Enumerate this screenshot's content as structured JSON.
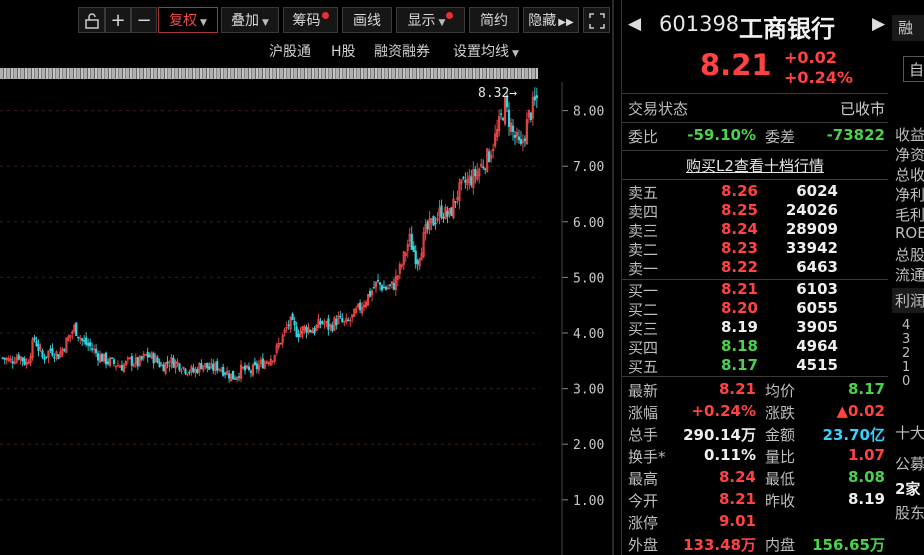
{
  "toolbar": {
    "plus": "+",
    "minus": "−",
    "fuquan": "复权",
    "diejia": "叠加",
    "chouma": "筹码",
    "huaxian": "画线",
    "xianshi": "显示",
    "jianyue": "简约",
    "yincang": "隐藏"
  },
  "subbar": {
    "hgt": "沪股通",
    "h_share": "H股",
    "margin": "融资融券",
    "set_ma": "设置均线"
  },
  "stock": {
    "code": "601398",
    "name": "工商银行",
    "price": "8.21",
    "change": "+0.02",
    "change_pct": "+0.24%"
  },
  "status": {
    "label": "交易状态",
    "value": "已收市"
  },
  "weibi": {
    "label1": "委比",
    "value1": "-59.10%",
    "label2": "委差",
    "value2": "-73822"
  },
  "l2_link": "购买L2查看十档行情",
  "asks": [
    {
      "label": "卖五",
      "price": "8.26",
      "vol": "6024"
    },
    {
      "label": "卖四",
      "price": "8.25",
      "vol": "24026"
    },
    {
      "label": "卖三",
      "price": "8.24",
      "vol": "28909"
    },
    {
      "label": "卖二",
      "price": "8.23",
      "vol": "33942"
    },
    {
      "label": "卖一",
      "price": "8.22",
      "vol": "6463"
    }
  ],
  "bids": [
    {
      "label": "买一",
      "price": "8.21",
      "vol": "6103"
    },
    {
      "label": "买二",
      "price": "8.20",
      "vol": "6055"
    },
    {
      "label": "买三",
      "price": "8.19",
      "vol": "3905"
    },
    {
      "label": "买四",
      "price": "8.18",
      "vol": "4964"
    },
    {
      "label": "买五",
      "price": "8.17",
      "vol": "4515"
    }
  ],
  "stats": [
    {
      "l1": "最新",
      "v1": "8.21",
      "l2": "均价",
      "v2": "8.17"
    },
    {
      "l1": "涨幅",
      "v1": "+0.24%",
      "l2": "涨跌",
      "v2": "▲0.02"
    },
    {
      "l1": "总手",
      "v1": "290.14万",
      "l2": "金额",
      "v2": "23.70亿"
    },
    {
      "l1": "换手*",
      "v1": "0.11%",
      "l2": "量比",
      "v2": "1.07"
    },
    {
      "l1": "最高",
      "v1": "8.24",
      "l2": "最低",
      "v2": "8.08"
    },
    {
      "l1": "今开",
      "v1": "8.21",
      "l2": "昨收",
      "v2": "8.19"
    },
    {
      "l1": "涨停",
      "v1": "9.01",
      "l2": "",
      "v2": ""
    },
    {
      "l1": "外盘",
      "v1": "133.48万",
      "l2": "内盘",
      "v2": "156.65万"
    }
  ],
  "edge": {
    "tab_top": "融",
    "btn": "自",
    "items": [
      "收益",
      "净资",
      "总收",
      "净利",
      "毛利",
      "ROE",
      "总股",
      "流通"
    ],
    "profit": "利润",
    "axis": [
      "4",
      "3",
      "2",
      "1",
      "0"
    ],
    "top10": "十大",
    "notice": "公募",
    "count": "2家",
    "holder": "股东"
  },
  "chart_data": {
    "type": "candlestick",
    "ylim": [
      0.3,
      8.5
    ],
    "yticks": [
      "8.00",
      "7.00",
      "6.00",
      "5.00",
      "4.00",
      "3.00",
      "2.00",
      "1.00"
    ],
    "max_label": "8.32",
    "close_path": [
      3.55,
      3.5,
      3.6,
      3.45,
      3.9,
      3.55,
      3.7,
      3.6,
      3.85,
      4.1,
      3.85,
      3.75,
      3.6,
      3.5,
      3.45,
      3.4,
      3.5,
      3.45,
      3.6,
      3.55,
      3.4,
      3.5,
      3.45,
      3.35,
      3.3,
      3.45,
      3.35,
      3.4,
      3.3,
      3.2,
      3.35,
      3.3,
      3.4,
      3.5,
      3.6,
      3.9,
      4.2,
      4.0,
      4.1,
      4.05,
      4.2,
      4.1,
      4.25,
      4.15,
      4.3,
      4.5,
      4.7,
      4.9,
      4.8,
      4.85,
      5.2,
      5.7,
      5.3,
      5.8,
      6.0,
      6.2,
      6.1,
      6.5,
      6.7,
      6.8,
      7.0,
      7.2,
      7.6,
      8.1,
      7.6,
      7.3,
      7.9,
      8.21
    ]
  }
}
